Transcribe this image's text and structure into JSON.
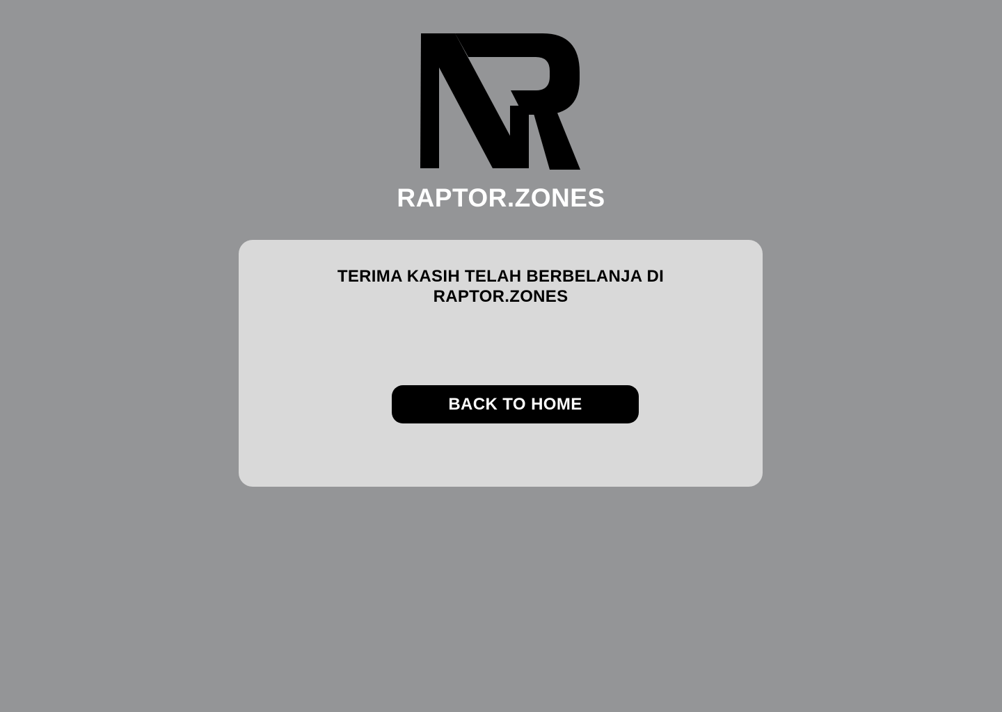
{
  "header": {
    "logo_icon": "nr-monogram-logo",
    "brand_name": "RAPTOR.ZONES"
  },
  "card": {
    "message": "TERIMA KASIH TELAH BERBELANJA DI RAPTOR.ZONES",
    "back_button_label": "BACK TO HOME"
  },
  "colors": {
    "background": "#949597",
    "card": "#d9d9d9",
    "button": "#000000",
    "brand_text": "#ffffff"
  }
}
